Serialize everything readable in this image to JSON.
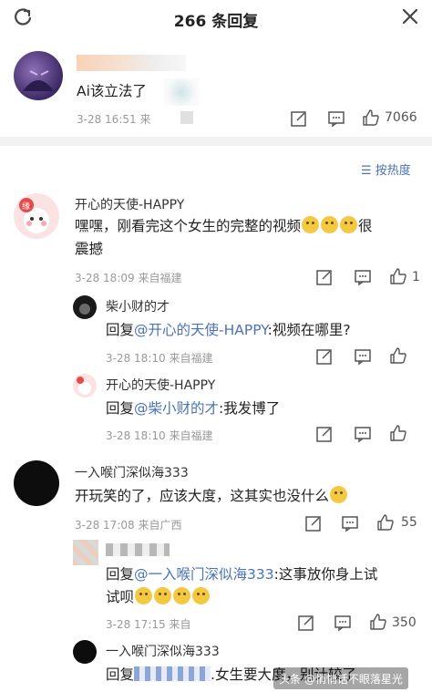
{
  "header": {
    "title": "266 条回复"
  },
  "main_post": {
    "text": "Ai该立法了",
    "time": "3-28 16:51",
    "source": "来",
    "likes": "7066"
  },
  "sort_label": "按热度",
  "comments": [
    {
      "name": "开心的天使-HAPPY",
      "text_line1": "嘿嘿，刚看完这个女生的完整的视频",
      "text_line2_suffix": "很",
      "text_line2": "震撼",
      "time": "3-28 18:09",
      "source": "来自福建",
      "likes": "1",
      "replies": [
        {
          "name": "柴小财的才",
          "prefix": "回复",
          "mention": "@开心的天使-HAPPY",
          "text": ":视频在哪里?",
          "time": "3-28 18:10",
          "source": "来自福建"
        },
        {
          "name": "开心的天使-HAPPY",
          "prefix": "回复",
          "mention": "@柴小财的才",
          "text": ":我发博了",
          "time": "3-28 18:10",
          "source": "来自福建"
        }
      ]
    },
    {
      "name": "一入喉门深似海333",
      "text": "开玩笑的了，应该大度，这其实也没什么",
      "time": "3-28 17:08",
      "source": "来自广西",
      "likes": "55",
      "replies": [
        {
          "prefix": "回复",
          "mention": "@一入喉门深似海333",
          "text": ":这事放你身上试",
          "text_line2": "试呗",
          "time": "3-28 17:15",
          "source": "来自",
          "likes": "350"
        },
        {
          "name": "一入喉门深似海333",
          "prefix": "回复",
          "text": ".女生要大度，别计较了"
        }
      ]
    }
  ],
  "watermark": "头条 @悄悄话不眼落星光",
  "colors": {
    "link": "#4a73b8",
    "meta": "#999999",
    "divider": "#f2f2f2"
  }
}
